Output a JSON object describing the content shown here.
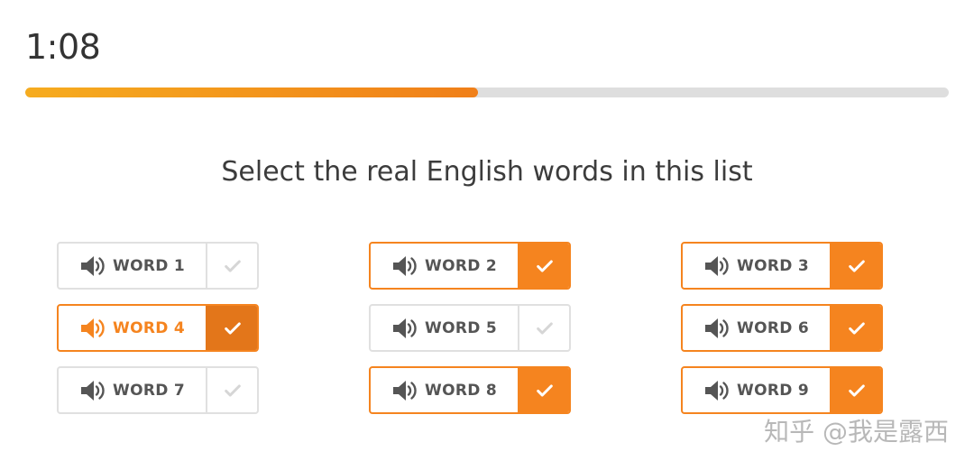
{
  "timer": {
    "value": "1:08"
  },
  "progress": {
    "fraction": 0.49
  },
  "instruction": "Select the real English words in this list",
  "colors": {
    "accent": "#f5841f",
    "accent_dark": "#e3761a",
    "track": "#dedede"
  },
  "words": [
    {
      "label": "WORD 1",
      "selected": false,
      "highlighted": false,
      "icon": "speaker-icon"
    },
    {
      "label": "WORD 2",
      "selected": true,
      "highlighted": false,
      "icon": "speaker-icon"
    },
    {
      "label": "WORD 3",
      "selected": true,
      "highlighted": false,
      "icon": "speaker-icon"
    },
    {
      "label": "WORD 4",
      "selected": true,
      "highlighted": true,
      "icon": "speaker-icon"
    },
    {
      "label": "WORD 5",
      "selected": false,
      "highlighted": false,
      "icon": "speaker-icon"
    },
    {
      "label": "WORD 6",
      "selected": true,
      "highlighted": false,
      "icon": "speaker-icon"
    },
    {
      "label": "WORD 7",
      "selected": false,
      "highlighted": false,
      "icon": "speaker-icon"
    },
    {
      "label": "WORD 8",
      "selected": true,
      "highlighted": false,
      "icon": "speaker-icon"
    },
    {
      "label": "WORD 9",
      "selected": true,
      "highlighted": false,
      "icon": "speaker-icon"
    }
  ],
  "watermark": "知乎 @我是露西"
}
